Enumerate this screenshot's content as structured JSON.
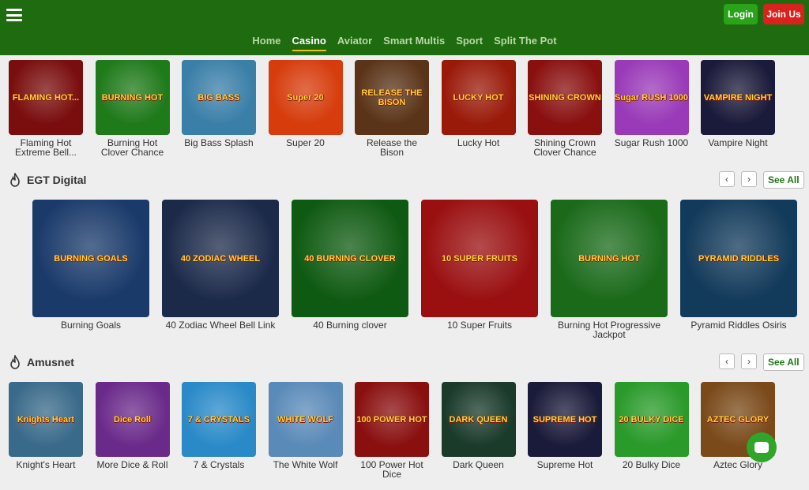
{
  "header": {
    "login_label": "Login",
    "join_label": "Join Us",
    "nav": [
      {
        "label": "Home"
      },
      {
        "label": "Casino"
      },
      {
        "label": "Aviator"
      },
      {
        "label": "Smart Multis"
      },
      {
        "label": "Sport"
      },
      {
        "label": "Split The Pot"
      }
    ],
    "active_nav": "Casino",
    "colors": {
      "bar": "#1f6b0f",
      "login": "#2aa31b",
      "join": "#d8221e",
      "active_underline": "#f2c500"
    }
  },
  "row1": {
    "games": [
      {
        "name": "Flaming Hot Extreme Bell...",
        "art": "FLAMING HOT...",
        "bg": "#7a0d0d"
      },
      {
        "name": "Burning Hot Clover Chance",
        "art": "BURNING HOT",
        "bg": "#1f7a1a"
      },
      {
        "name": "Big Bass Splash",
        "art": "BIG BASS",
        "bg": "#3a7fa8"
      },
      {
        "name": "Super 20",
        "art": "Super 20",
        "bg": "#d63c0c"
      },
      {
        "name": "Release the Bison",
        "art": "RELEASE THE BISON",
        "bg": "#5a3418"
      },
      {
        "name": "Lucky Hot",
        "art": "LUCKY HOT",
        "bg": "#9a1a0a"
      },
      {
        "name": "Shining Crown Clover Chance",
        "art": "SHINING CROWN",
        "bg": "#8a1010"
      },
      {
        "name": "Sugar Rush 1000",
        "art": "Sugar RUSH 1000",
        "bg": "#9a3ab8"
      },
      {
        "name": "Vampire Night",
        "art": "VAMPIRE NIGHT",
        "bg": "#1a1a3a"
      }
    ]
  },
  "egt": {
    "title": "EGT Digital",
    "see_all": "See All",
    "games": [
      {
        "name": "Burning Goals",
        "art": "BURNING GOALS",
        "bg": "#1a3a6a"
      },
      {
        "name": "40 Zodiac Wheel Bell Link",
        "art": "40 ZODIAC WHEEL",
        "bg": "#1c2a4a"
      },
      {
        "name": "40 Burning clover",
        "art": "40 BURNING CLOVER",
        "bg": "#0f5a12"
      },
      {
        "name": "10 Super Fruits",
        "art": "10 SUPER FRUITS",
        "bg": "#9a0f10"
      },
      {
        "name": "Burning Hot Progressive Jackpot",
        "art": "BURNING HOT",
        "bg": "#1a6a1a"
      },
      {
        "name": "Pyramid Riddles Osiris",
        "art": "PYRAMID RIDDLES",
        "bg": "#123a5a"
      }
    ]
  },
  "amusnet": {
    "title": "Amusnet",
    "see_all": "See All",
    "games": [
      {
        "name": "Knight's Heart",
        "art": "Knights Heart",
        "bg": "#3a6a8a"
      },
      {
        "name": "More Dice & Roll",
        "art": "Dice Roll",
        "bg": "#6a2a8a"
      },
      {
        "name": "7 & Crystals",
        "art": "7 & CRYSTALS",
        "bg": "#2a8ac8"
      },
      {
        "name": "The White Wolf",
        "art": "WHITE WOLF",
        "bg": "#5a8ab8"
      },
      {
        "name": "100 Power Hot Dice",
        "art": "100 POWER HOT",
        "bg": "#8a1010"
      },
      {
        "name": "Dark Queen",
        "art": "DARK QUEEN",
        "bg": "#1a3a2a"
      },
      {
        "name": "Supreme Hot",
        "art": "SUPREME HOT",
        "bg": "#1a1a3a"
      },
      {
        "name": "20 Bulky Dice",
        "art": "20 BULKY DICE",
        "bg": "#2a9a2a"
      },
      {
        "name": "Aztec Glory",
        "art": "AZTEC GLORY",
        "bg": "#7a4a1a"
      }
    ]
  }
}
